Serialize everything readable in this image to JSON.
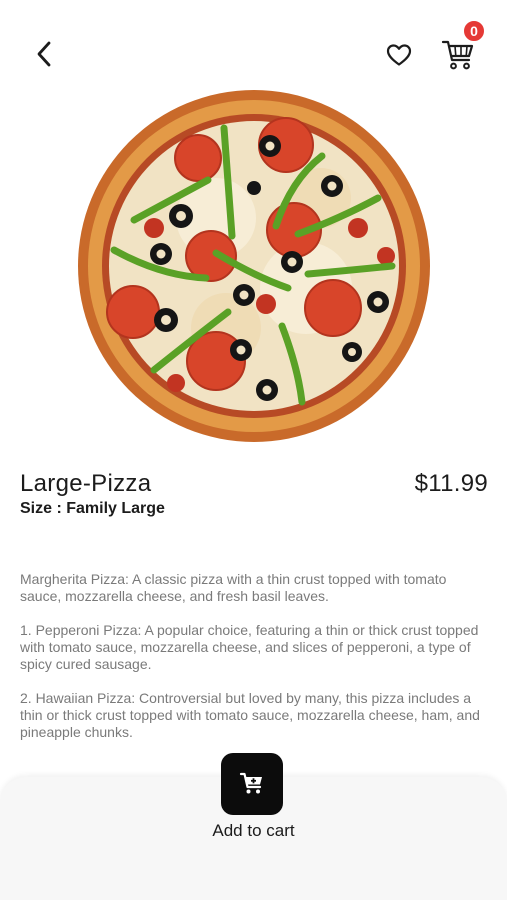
{
  "header": {
    "back_icon": "chevron-left-icon",
    "favorite_icon": "heart-icon",
    "cart_icon": "shopping-cart-icon",
    "cart_count": "0",
    "badge_color": "#e53935"
  },
  "product": {
    "image_icon": "pizza-image",
    "title": "Large-Pizza",
    "price": "$11.99",
    "size_label": "Size :",
    "size_value": "Family Large"
  },
  "description": {
    "paragraphs": [
      "Margherita Pizza: A classic pizza with a thin crust topped with tomato sauce, mozzarella cheese, and fresh basil leaves.",
      "1. Pepperoni Pizza: A popular choice, featuring a thin or thick crust topped with tomato sauce, mozzarella cheese, and slices of pepperoni, a type of spicy cured sausage.",
      "2. Hawaiian Pizza: Controversial but loved by many, this pizza includes a thin or thick crust topped with tomato sauce, mozzarella cheese, ham, and pineapple chunks."
    ]
  },
  "footer": {
    "add_to_cart_label": "Add to cart",
    "add_to_cart_icon": "cart-add-icon",
    "button_color": "#0c0c0c"
  }
}
